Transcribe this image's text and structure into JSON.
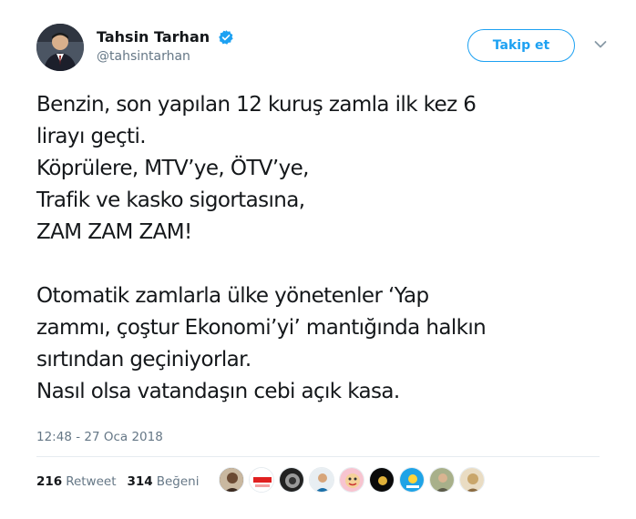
{
  "author": {
    "display_name": "Tahsin Tarhan",
    "handle": "@tahsintarhan",
    "avatar_icon": "person-photo-avatar",
    "verified_icon": "verified-badge-icon",
    "verified_color": "#1da1f2"
  },
  "follow_button": {
    "label": "Takip et",
    "color": "#1da1f2"
  },
  "tweet": {
    "lines": [
      "Benzin, son yapılan 12 kuruş zamla ilk kez 6",
      "lirayı geçti.",
      "Köprülere, MTV’ye, ÖTV’ye,",
      "Trafik ve kasko sigortasına,",
      "ZAM ZAM ZAM!",
      "",
      "Otomatik zamlarla ülke yönetenler ‘Yap",
      "zammı, çoştur Ekonomi’yi’ mantığında halkın",
      "sırtından geçiniyorlar.",
      "Nasıl olsa vatandaşın cebi açık kasa."
    ],
    "timestamp": "12:48 - 27 Oca 2018"
  },
  "stats": {
    "retweets_count": "216",
    "retweets_label": "Retweet",
    "likes_count": "314",
    "likes_label": "Beğeni"
  },
  "liker_avatars": [
    {
      "icon": "liker-avatar-1",
      "color": "#5a3a2a"
    },
    {
      "icon": "liker-avatar-2",
      "color": "#e02020"
    },
    {
      "icon": "liker-avatar-3",
      "color": "#222222"
    },
    {
      "icon": "liker-avatar-4",
      "color": "#1a6fa8"
    },
    {
      "icon": "liker-avatar-5",
      "color": "#e86a8a"
    },
    {
      "icon": "liker-avatar-6",
      "color": "#0a0a0a"
    },
    {
      "icon": "liker-avatar-7",
      "color": "#1fa3e6"
    },
    {
      "icon": "liker-avatar-8",
      "color": "#8a8a7a"
    },
    {
      "icon": "liker-avatar-9",
      "color": "#c9a66b"
    }
  ]
}
